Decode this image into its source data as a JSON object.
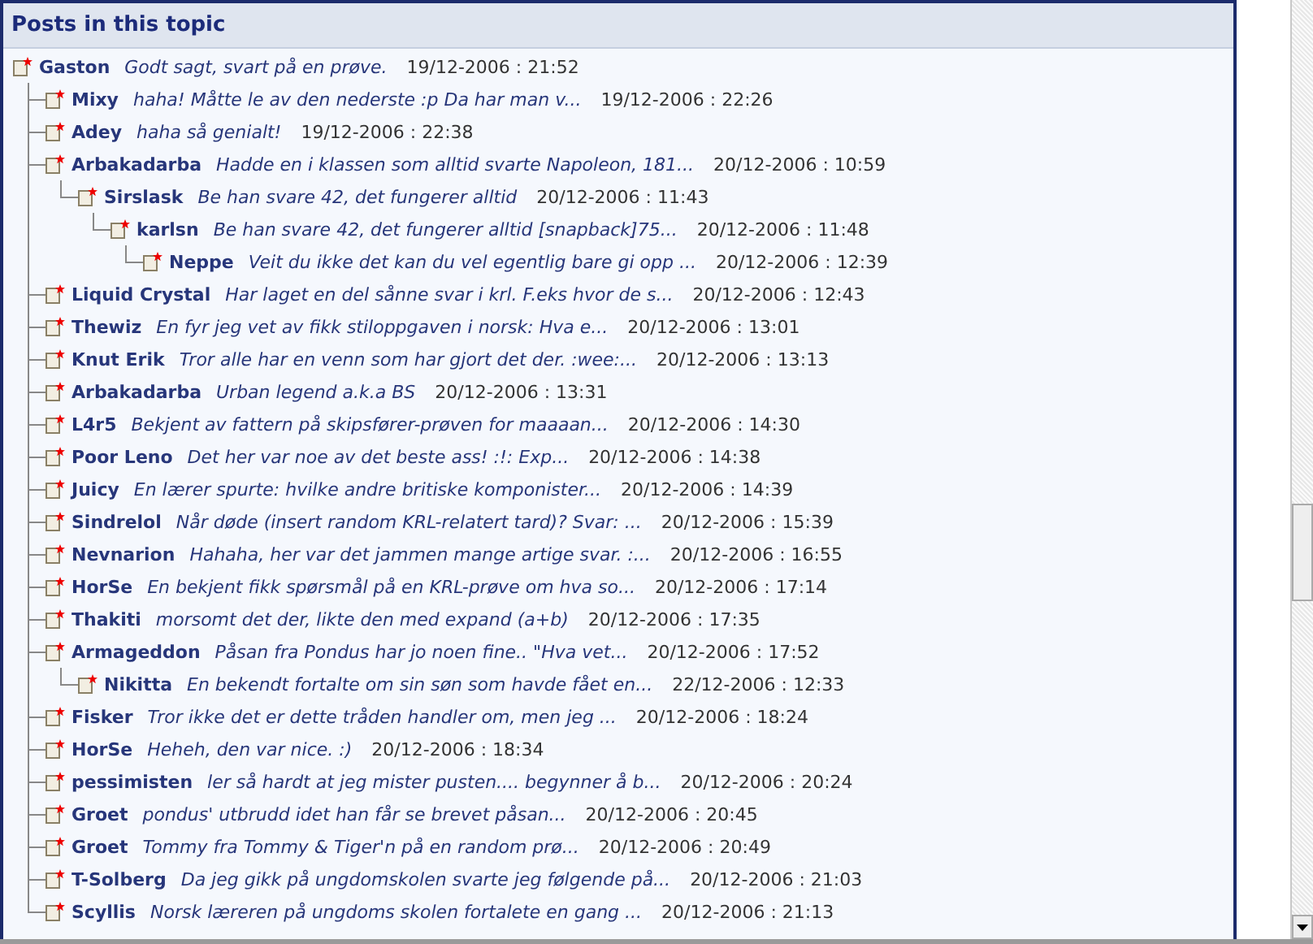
{
  "panel": {
    "title": "Posts in this topic",
    "posts": [
      {
        "author": "Gaston",
        "message": "Godt sagt, svart på en prøve.",
        "date": "19/12-2006 : 21:52",
        "children": [
          {
            "author": "Mixy",
            "message": "haha! Måtte le av den nederste :p Da har man v...",
            "date": "19/12-2006 : 22:26"
          },
          {
            "author": "Adey",
            "message": "haha så genialt!",
            "date": "19/12-2006 : 22:38"
          },
          {
            "author": "Arbakadarba",
            "message": "Hadde en i klassen som alltid svarte Napoleon, 181...",
            "date": "20/12-2006 : 10:59",
            "children": [
              {
                "author": "Sirslask",
                "message": "Be han svare 42, det fungerer alltid",
                "date": "20/12-2006 : 11:43",
                "children": [
                  {
                    "author": "karlsn",
                    "message": "Be han svare 42, det fungerer alltid [snapback]75...",
                    "date": "20/12-2006 : 11:48",
                    "children": [
                      {
                        "author": "Neppe",
                        "message": "Veit du ikke det kan du vel egentlig bare gi opp ...",
                        "date": "20/12-2006 : 12:39"
                      }
                    ]
                  }
                ]
              }
            ]
          },
          {
            "author": "Liquid Crystal",
            "message": "Har laget en del sånne svar i krl. F.eks hvor de s...",
            "date": "20/12-2006 : 12:43"
          },
          {
            "author": "Thewiz",
            "message": "En fyr jeg vet av fikk stiloppgaven i norsk: Hva e...",
            "date": "20/12-2006 : 13:01"
          },
          {
            "author": "Knut Erik",
            "message": "Tror alle har en venn som har gjort det der. :wee:...",
            "date": "20/12-2006 : 13:13"
          },
          {
            "author": "Arbakadarba",
            "message": "Urban legend a.k.a BS",
            "date": "20/12-2006 : 13:31"
          },
          {
            "author": "L4r5",
            "message": "Bekjent av fattern på skipsfører-prøven for maaaan...",
            "date": "20/12-2006 : 14:30"
          },
          {
            "author": "Poor Leno",
            "message": "Det her var noe av det beste ass! :!: Exp...",
            "date": "20/12-2006 : 14:38"
          },
          {
            "author": "Juicy",
            "message": "En lærer spurte: hvilke andre britiske komponister...",
            "date": "20/12-2006 : 14:39"
          },
          {
            "author": "Sindrelol",
            "message": "Når døde (insert random KRL-relatert tard)? Svar: ...",
            "date": "20/12-2006 : 15:39"
          },
          {
            "author": "Nevnarion",
            "message": "Hahaha, her var det jammen mange artige svar. :...",
            "date": "20/12-2006 : 16:55"
          },
          {
            "author": "HorSe",
            "message": "En bekjent fikk spørsmål på en KRL-prøve om hva so...",
            "date": "20/12-2006 : 17:14"
          },
          {
            "author": "Thakiti",
            "message": "morsomt det der, likte den med expand (a+b)",
            "date": "20/12-2006 : 17:35"
          },
          {
            "author": "Armageddon",
            "message": "Påsan fra Pondus har jo noen fine.. \"Hva vet...",
            "date": "20/12-2006 : 17:52",
            "children": [
              {
                "author": "Nikitta",
                "message": "En bekendt fortalte om sin søn som havde fået en...",
                "date": "22/12-2006 : 12:33"
              }
            ]
          },
          {
            "author": "Fisker",
            "message": "Tror ikke det er dette tråden handler om, men jeg ...",
            "date": "20/12-2006 : 18:24"
          },
          {
            "author": "HorSe",
            "message": "Heheh, den var nice. :)",
            "date": "20/12-2006 : 18:34"
          },
          {
            "author": "pessimisten",
            "message": "ler så hardt at jeg mister pusten.... begynner å b...",
            "date": "20/12-2006 : 20:24"
          },
          {
            "author": "Groet",
            "message": "pondus' utbrudd idet han får se brevet påsan...",
            "date": "20/12-2006 : 20:45"
          },
          {
            "author": "Groet",
            "message": "Tommy fra Tommy & Tiger'n på en random prø...",
            "date": "20/12-2006 : 20:49"
          },
          {
            "author": "T-Solberg",
            "message": "Da jeg gikk på ungdomskolen svarte jeg følgende på...",
            "date": "20/12-2006 : 21:03"
          },
          {
            "author": "Scyllis",
            "message": "Norsk læreren på ungdoms skolen fortalete en gang ...",
            "date": "20/12-2006 : 21:13"
          }
        ]
      }
    ]
  }
}
